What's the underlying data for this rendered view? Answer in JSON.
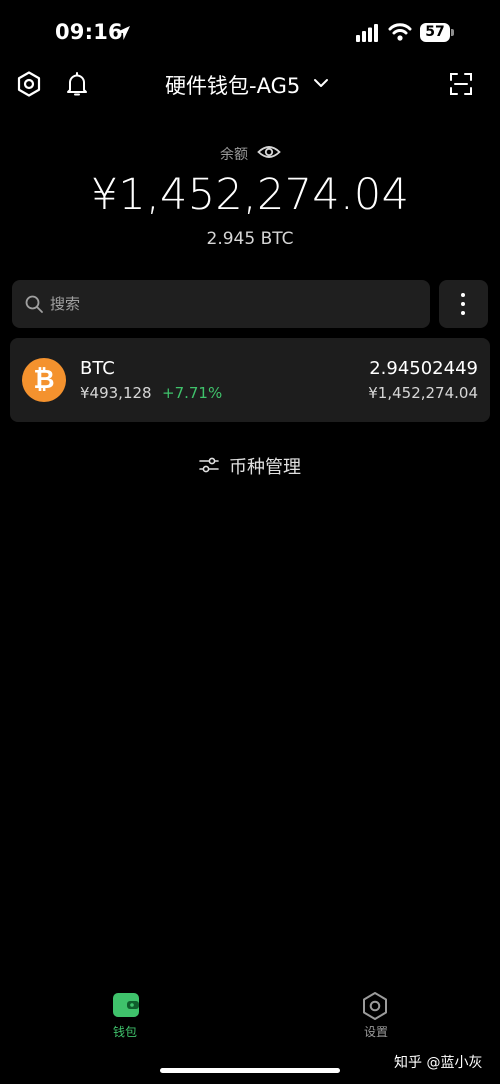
{
  "status": {
    "time": "09:16",
    "battery": "57"
  },
  "header": {
    "wallet_name": "硬件钱包-AG5"
  },
  "balance": {
    "label": "余额",
    "fiat": "¥1,452,274.04",
    "btc": "2.945 BTC"
  },
  "search": {
    "placeholder": "搜索"
  },
  "assets": [
    {
      "symbol": "BTC",
      "logo_glyph": "₿",
      "price": "¥493,128",
      "change": "+7.71%",
      "amount": "2.94502449",
      "value": "¥1,452,274.04"
    }
  ],
  "manage": {
    "label": "币种管理"
  },
  "nav": {
    "wallet_label": "钱包",
    "settings_label": "设置"
  },
  "watermark": "知乎 @蓝小灰",
  "colors": {
    "background": "#000000",
    "card": "#1d1d1d",
    "accent_green": "#3fc26b",
    "btc_orange": "#f4922e"
  }
}
